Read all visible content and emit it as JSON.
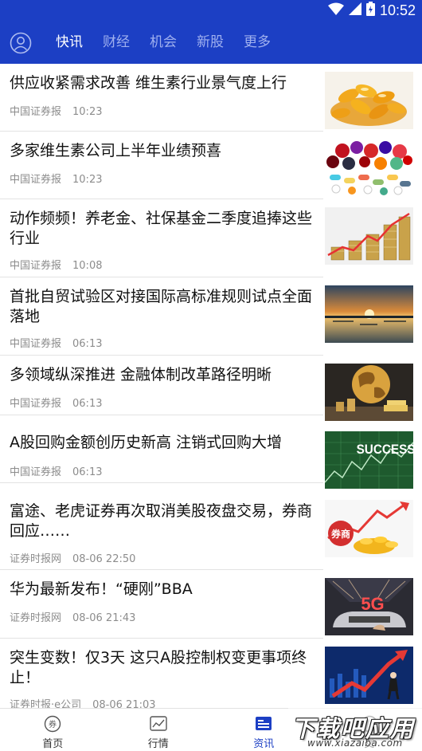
{
  "status_bar": {
    "time": "10:52"
  },
  "header": {
    "tabs": [
      {
        "label": "快讯",
        "active": true
      },
      {
        "label": "财经",
        "active": false
      },
      {
        "label": "机会",
        "active": false
      },
      {
        "label": "新股",
        "active": false
      },
      {
        "label": "更多",
        "active": false
      }
    ]
  },
  "news": [
    {
      "title": "供应收紧需求改善 维生素行业景气度上行",
      "source": "中国证券报",
      "time": "10:23",
      "image": "vitamin-capsules"
    },
    {
      "title": "多家维生素公司上半年业绩预喜",
      "source": "中国证券报",
      "time": "10:23",
      "image": "fruits-and-pills"
    },
    {
      "title": "动作频频！养老金、社保基金二季度追捧这些行业",
      "source": "中国证券报",
      "time": "10:08",
      "image": "coins-growth-chart"
    },
    {
      "title": "首批自贸试验区对接国际高标准规则试点全面落地",
      "source": "中国证券报",
      "time": "06:13",
      "image": "sunset-lake"
    },
    {
      "title": "多领域纵深推进 金融体制改革路径明晰",
      "source": "中国证券报",
      "time": "06:13",
      "image": "globe-coins-gold"
    },
    {
      "title": "A股回购金额创历史新高 注销式回购大增",
      "source": "中国证券报",
      "time": "06:13",
      "image": "success-chart",
      "image_text": "SUCCESS"
    },
    {
      "title": "富途、老虎证券再次取消美股夜盘交易，券商回应……",
      "source": "证券时报网",
      "time": "08-06 22:50",
      "image": "broker-coins",
      "image_text": "券商"
    },
    {
      "title": "华为最新发布！“硬刚”BBA",
      "source": "证券时报网",
      "time": "08-06 21:43",
      "image": "5g-car",
      "image_text": "5G"
    },
    {
      "title": "突生变数！仅3天 这只A股控制权变更事项终止！",
      "source": "证券时报·e公司",
      "time": "08-06 21:03",
      "image": "stock-arrow-man"
    }
  ],
  "bottom_nav": {
    "items": [
      {
        "label": "首页",
        "icon": "home-coupon-icon"
      },
      {
        "label": "行情",
        "icon": "market-chart-icon"
      },
      {
        "label": "资讯",
        "icon": "news-icon",
        "active": true
      },
      {
        "label": "交",
        "icon": "trade-icon"
      }
    ]
  },
  "watermark": {
    "main": "下载吧应用",
    "url": "www.xiazaiba.com"
  },
  "colors": {
    "brand_blue": "#1c3fc4",
    "tab_inactive": "#9fb0ef",
    "meta_gray": "#8c8c8c"
  }
}
